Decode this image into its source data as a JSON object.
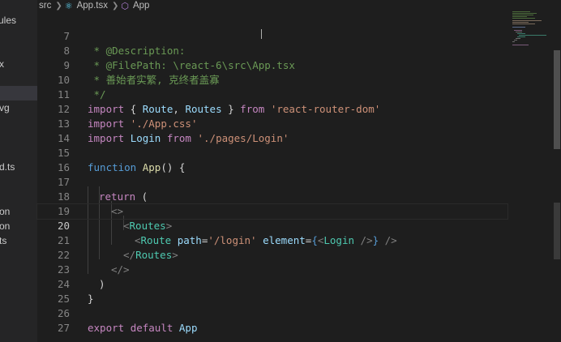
{
  "breadcrumb": {
    "folder": "src",
    "file": "App.tsx",
    "symbol": "App",
    "file_icon": "react-icon",
    "symbol_icon": "cube-icon"
  },
  "sidebar": {
    "items": [
      {
        "label": "ules"
      },
      {
        "label": "x"
      },
      {
        "label": ""
      },
      {
        "label": "vg"
      },
      {
        "label": "d.ts"
      },
      {
        "label": "on"
      },
      {
        "label": "on"
      },
      {
        "label": "ts"
      }
    ]
  },
  "editor": {
    "active_line": "20",
    "lines": [
      {
        "n": "7"
      },
      {
        "n": "8"
      },
      {
        "n": "9"
      },
      {
        "n": "10"
      },
      {
        "n": "11"
      },
      {
        "n": "12"
      },
      {
        "n": "13"
      },
      {
        "n": "14"
      },
      {
        "n": "15"
      },
      {
        "n": "16"
      },
      {
        "n": "17"
      },
      {
        "n": "18"
      },
      {
        "n": "19"
      },
      {
        "n": "20"
      },
      {
        "n": "21"
      },
      {
        "n": "22"
      },
      {
        "n": "23"
      },
      {
        "n": "24"
      },
      {
        "n": "25"
      },
      {
        "n": "26"
      },
      {
        "n": "27"
      }
    ],
    "tokens": {
      "l7_a": " * @Description:",
      "l8_a": " * @FilePath: \\react-6\\src\\App.tsx",
      "l9_a": " * 善始者实繁, 克终者盖寡",
      "l10_a": " */",
      "l11_kw": "import",
      "l11_b": " { ",
      "l11_c": "Route",
      "l11_d": ", ",
      "l11_e": "Routes",
      "l11_f": " } ",
      "l11_g": "from",
      "l11_h": " ",
      "l11_i": "'react-router-dom'",
      "l12_kw": "import",
      "l12_b": " ",
      "l12_c": "'./App.css'",
      "l13_kw": "import",
      "l13_b": " ",
      "l13_c": "Login",
      "l13_d": " ",
      "l13_e": "from",
      "l13_f": " ",
      "l13_g": "'./pages/Login'",
      "l15_kw": "function",
      "l15_b": " ",
      "l15_c": "App",
      "l15_d": "() {",
      "l17_kw": "return",
      "l17_b": " (",
      "l18_a": "<>",
      "l19_a": "<",
      "l19_b": "Routes",
      "l19_c": ">",
      "l20_a": "<",
      "l20_b": "Route",
      "l20_c": " ",
      "l20_d": "path",
      "l20_e": "=",
      "l20_f": "'/login'",
      "l20_g": " ",
      "l20_h": "element",
      "l20_i": "=",
      "l20_j": "{",
      "l20_k": "<",
      "l20_l": "Login",
      "l20_m": " />",
      "l20_n": "}",
      "l20_o": " />",
      "l21_a": "</",
      "l21_b": "Routes",
      "l21_c": ">",
      "l22_a": "</>",
      "l23_a": ")",
      "l24_a": "}",
      "l26_kw": "export",
      "l26_b": " ",
      "l26_c": "default",
      "l26_d": " ",
      "l26_e": "App"
    }
  },
  "colors": {
    "background": "#1e1e1e",
    "keyword": "#569cd6",
    "control_keyword": "#c586c0",
    "string": "#ce9178",
    "comment": "#6a9955",
    "tag": "#4ec9b0",
    "attribute": "#9cdcfe",
    "function": "#dcdcaa"
  }
}
